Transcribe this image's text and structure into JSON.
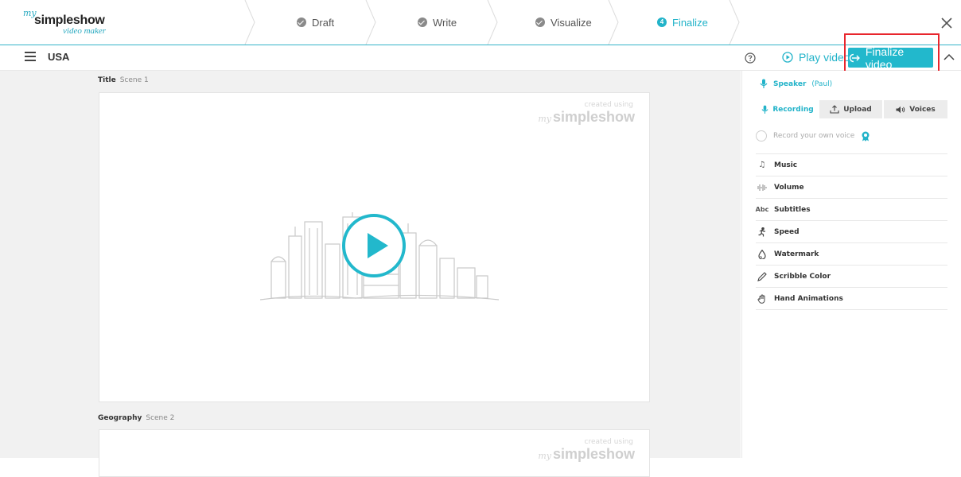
{
  "logo": {
    "prefix": "my",
    "brand": "simpleshow",
    "subtitle": "video maker"
  },
  "wizard": {
    "steps": [
      {
        "label": "Draft",
        "state": "done"
      },
      {
        "label": "Write",
        "state": "done"
      },
      {
        "label": "Visualize",
        "state": "done"
      },
      {
        "label": "Finalize",
        "state": "active",
        "number": "4"
      }
    ]
  },
  "toolbar": {
    "project_name": "USA",
    "play_label": "Play video",
    "finalize_label": "Finalize video"
  },
  "scenes": [
    {
      "title": "Title",
      "scene": "Scene 1"
    },
    {
      "title": "Geography",
      "scene": "Scene 2"
    }
  ],
  "watermark": {
    "created": "created using",
    "prefix": "my",
    "brand": "simpleshow"
  },
  "sidebar": {
    "speaker_label": "Speaker",
    "speaker_voice": "(Paul)",
    "tabs": {
      "recording": "Recording",
      "upload": "Upload",
      "voices": "Voices"
    },
    "own_voice": "Record your own voice",
    "settings": [
      {
        "label": "Music",
        "icon": "music-note-icon"
      },
      {
        "label": "Volume",
        "icon": "volume-icon"
      },
      {
        "label": "Subtitles",
        "icon": "subtitles-icon"
      },
      {
        "label": "Speed",
        "icon": "speed-icon"
      },
      {
        "label": "Watermark",
        "icon": "watermark-icon"
      },
      {
        "label": "Scribble Color",
        "icon": "pen-icon"
      },
      {
        "label": "Hand Animations",
        "icon": "hand-icon"
      }
    ]
  },
  "colors": {
    "accent": "#22b8cc",
    "highlight": "#e8262d",
    "gutter": "#f1f1f1"
  }
}
